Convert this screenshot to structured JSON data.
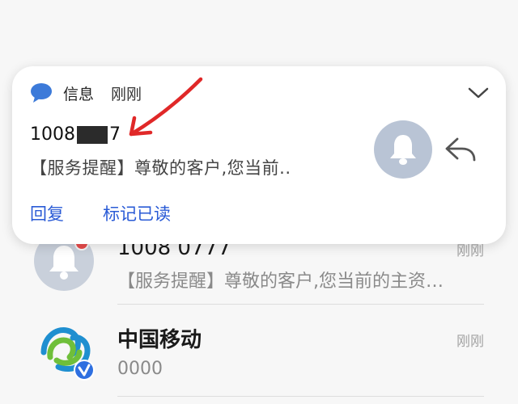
{
  "notification": {
    "app_name": "信息",
    "time": "刚刚",
    "app_icon": "message-bubble-icon",
    "collapse_icon": "chevron-down-icon",
    "sender_prefix": "1008",
    "sender_suffix": "7",
    "body": "【服务提醒】尊敬的客户,您当前..",
    "bell_icon": "bell-icon",
    "reply_icon": "reply-arrow-icon",
    "actions": [
      "回复",
      "标记已读"
    ],
    "accent_color": "#2a5bd6"
  },
  "conversations": [
    {
      "title": "1008 0777",
      "preview": "【服务提醒】尊敬的客户,您当前的主资…",
      "time": "刚刚",
      "avatar_icon": "bell-avatar-icon",
      "unread": true
    },
    {
      "title": "中国移动",
      "preview": "0000",
      "time": "刚刚",
      "avatar_icon": "china-mobile-logo-icon",
      "verified": true
    }
  ]
}
